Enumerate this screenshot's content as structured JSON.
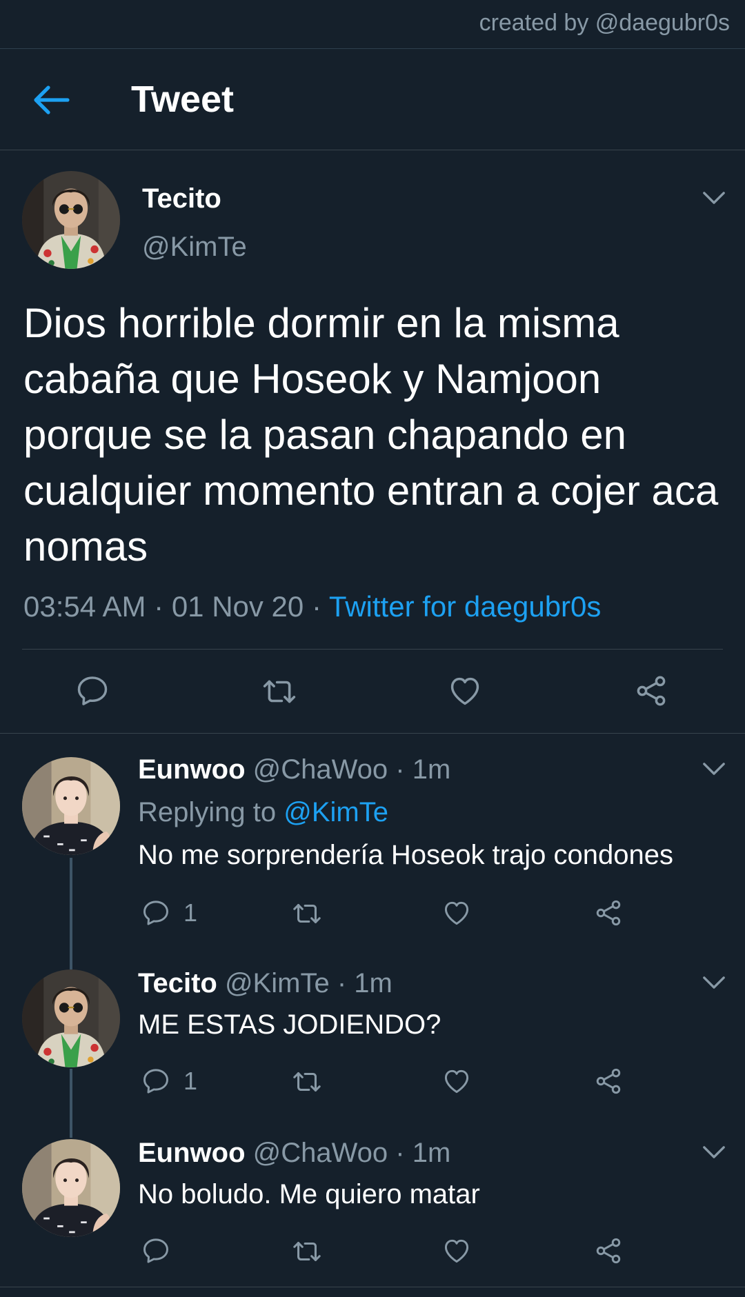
{
  "credit": "created by @daegubr0s",
  "header": {
    "title": "Tweet"
  },
  "main_tweet": {
    "name": "Tecito",
    "handle": "@KimTe",
    "text": "Dios horrible dormir en la misma cabaña que Hoseok y Namjoon porque se la pasan chapando en cualquier momento entran a cojer aca nomas",
    "time": "03:54 AM",
    "date": "01 Nov 20",
    "dot": "·",
    "source": "Twitter for daegubr0s"
  },
  "replies": [
    {
      "name": "Eunwoo",
      "handle": "@ChaWoo",
      "time": "1m",
      "dot": "·",
      "replying_label": "Replying to",
      "replying_to": "@KimTe",
      "text": "No me sorprendería Hoseok trajo condones",
      "reply_count": "1"
    },
    {
      "name": "Tecito",
      "handle": "@KimTe",
      "time": "1m",
      "dot": "·",
      "text": "ME ESTAS JODIENDO?",
      "reply_count": "1"
    },
    {
      "name": "Eunwoo",
      "handle": "@ChaWoo",
      "time": "1m",
      "dot": "·",
      "text": "No boludo. Me quiero matar",
      "reply_count": ""
    }
  ],
  "icons": {
    "back": "arrow-left-icon",
    "reply": "comment-icon",
    "retweet": "retweet-icon",
    "like": "heart-icon",
    "share": "share-icon",
    "more": "chevron-down-icon"
  },
  "colors": {
    "background": "#15202b",
    "accent": "#1da1f2",
    "secondary_text": "#8899a6",
    "divider": "#38444d"
  }
}
